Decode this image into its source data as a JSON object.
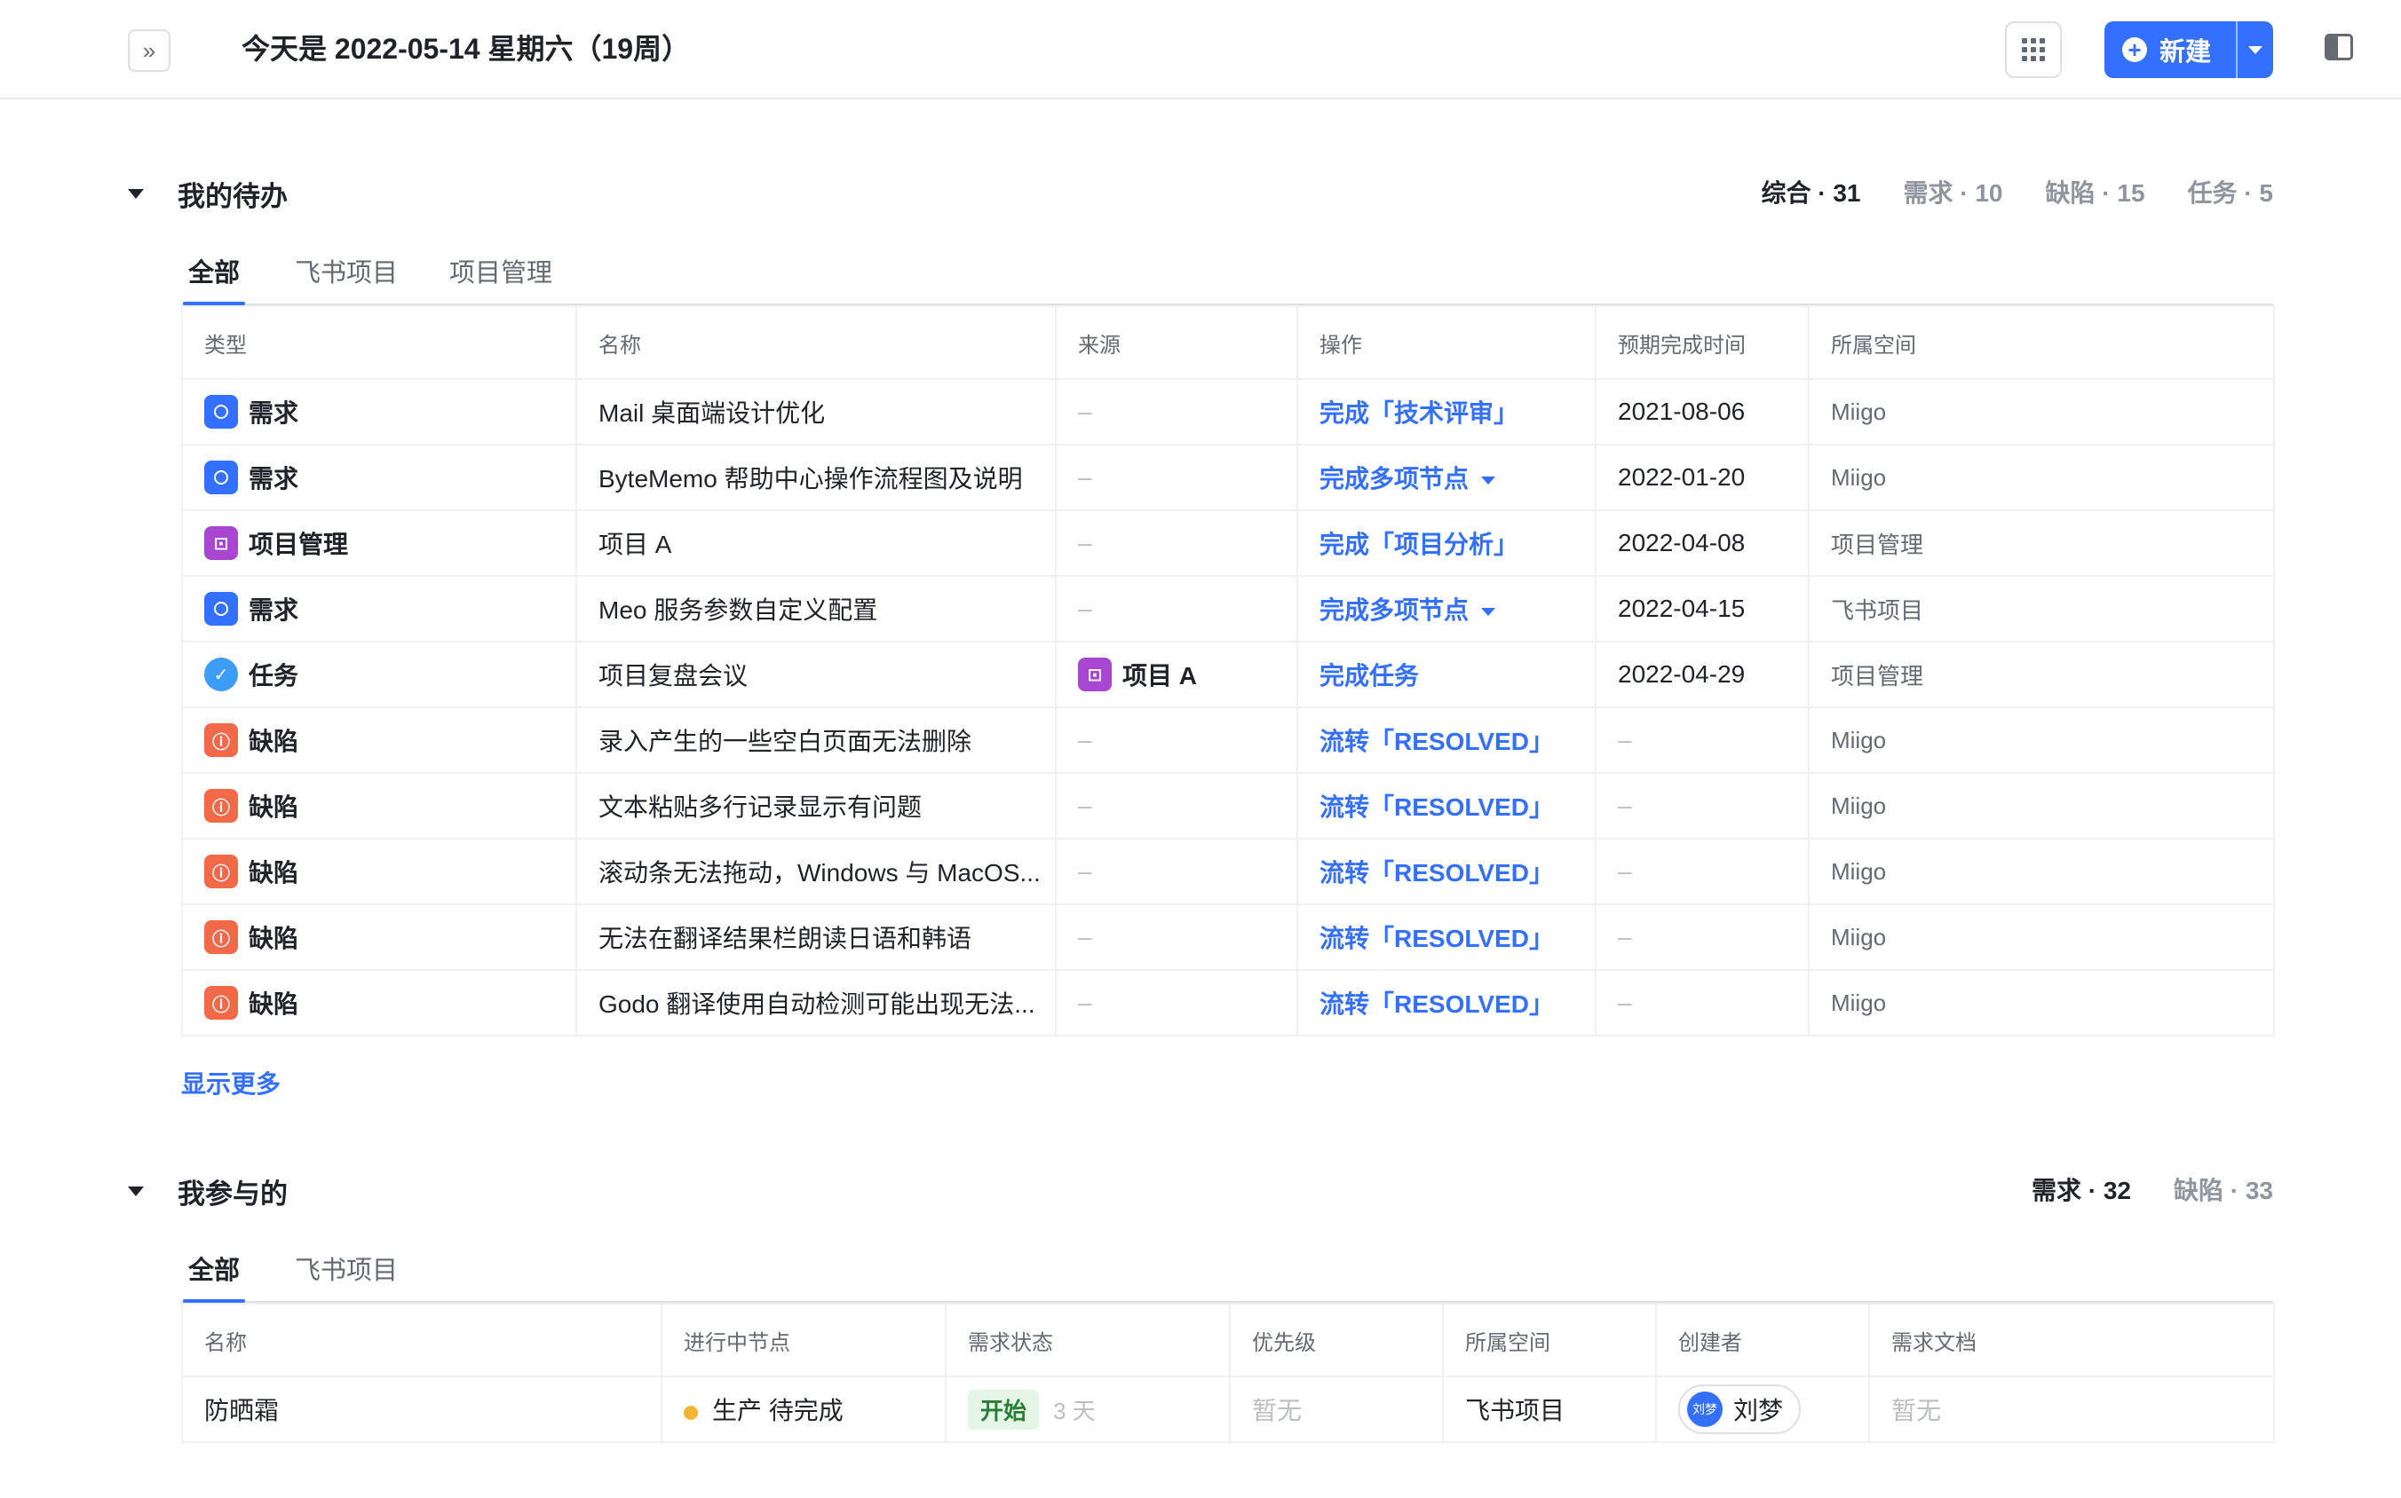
{
  "header": {
    "title": "今天是 2022-05-14 星期六（19周）",
    "expand_icon": "»",
    "new_label": "新建"
  },
  "todo": {
    "title": "我的待办",
    "stats": [
      {
        "label": "综合 · 31",
        "active": true
      },
      {
        "label": "需求 · 10",
        "active": false
      },
      {
        "label": "缺陷 · 15",
        "active": false
      },
      {
        "label": "任务 · 5",
        "active": false
      }
    ],
    "tabs": [
      "全部",
      "飞书项目",
      "项目管理"
    ],
    "columns": [
      "类型",
      "名称",
      "来源",
      "操作",
      "预期完成时间",
      "所属空间"
    ],
    "rows": [
      {
        "type": "需求",
        "kind": "req",
        "name": "Mail 桌面端设计优化",
        "source": "–",
        "op": "完成「技术评审」",
        "op_menu": false,
        "due": "2021-08-06",
        "space": "Miigo"
      },
      {
        "type": "需求",
        "kind": "req",
        "name": "ByteMemo 帮助中心操作流程图及说明",
        "source": "–",
        "op": "完成多项节点",
        "op_menu": true,
        "due": "2022-01-20",
        "space": "Miigo"
      },
      {
        "type": "项目管理",
        "kind": "proj",
        "name": "项目 A",
        "source": "–",
        "op": "完成「项目分析」",
        "op_menu": false,
        "due": "2022-04-08",
        "space": "项目管理"
      },
      {
        "type": "需求",
        "kind": "req",
        "name": "Meo 服务参数自定义配置",
        "source": "–",
        "op": "完成多项节点",
        "op_menu": true,
        "due": "2022-04-15",
        "space": "飞书项目"
      },
      {
        "type": "任务",
        "kind": "task",
        "name": "项目复盘会议",
        "source": "项目 A",
        "op": "完成任务",
        "op_menu": false,
        "due": "2022-04-29",
        "space": "项目管理"
      },
      {
        "type": "缺陷",
        "kind": "bug",
        "name": "录入产生的一些空白页面无法删除",
        "source": "–",
        "op": "流转「RESOLVED」",
        "op_menu": false,
        "due": "–",
        "space": "Miigo"
      },
      {
        "type": "缺陷",
        "kind": "bug",
        "name": "文本粘贴多行记录显示有问题",
        "source": "–",
        "op": "流转「RESOLVED」",
        "op_menu": false,
        "due": "–",
        "space": "Miigo"
      },
      {
        "type": "缺陷",
        "kind": "bug",
        "name": "滚动条无法拖动，Windows 与 MacOS...",
        "source": "–",
        "op": "流转「RESOLVED」",
        "op_menu": false,
        "due": "–",
        "space": "Miigo"
      },
      {
        "type": "缺陷",
        "kind": "bug",
        "name": "无法在翻译结果栏朗读日语和韩语",
        "source": "–",
        "op": "流转「RESOLVED」",
        "op_menu": false,
        "due": "–",
        "space": "Miigo"
      },
      {
        "type": "缺陷",
        "kind": "bug",
        "name": "Godo 翻译使用自动检测可能出现无法...",
        "source": "–",
        "op": "流转「RESOLVED」",
        "op_menu": false,
        "due": "–",
        "space": "Miigo"
      }
    ],
    "show_more": "显示更多"
  },
  "involved": {
    "title": "我参与的",
    "stats": [
      {
        "label": "需求 · 32",
        "active": true
      },
      {
        "label": "缺陷 · 33",
        "active": false
      }
    ],
    "tabs": [
      "全部",
      "飞书项目"
    ],
    "columns": [
      "名称",
      "进行中节点",
      "需求状态",
      "优先级",
      "所属空间",
      "创建者",
      "需求文档"
    ],
    "rows": [
      {
        "name": "防晒霜",
        "node": "生产  待完成",
        "status": "开始",
        "days": "3 天",
        "priority": "暂无",
        "space": "飞书项目",
        "creator": "刘梦",
        "avatar": "刘梦",
        "doc": "暂无"
      }
    ]
  },
  "colors": {
    "accent": "#3370ff",
    "req": "#3370ff",
    "proj": "#a846d1",
    "task": "#3d9cf5",
    "bug": "#f2694a"
  }
}
